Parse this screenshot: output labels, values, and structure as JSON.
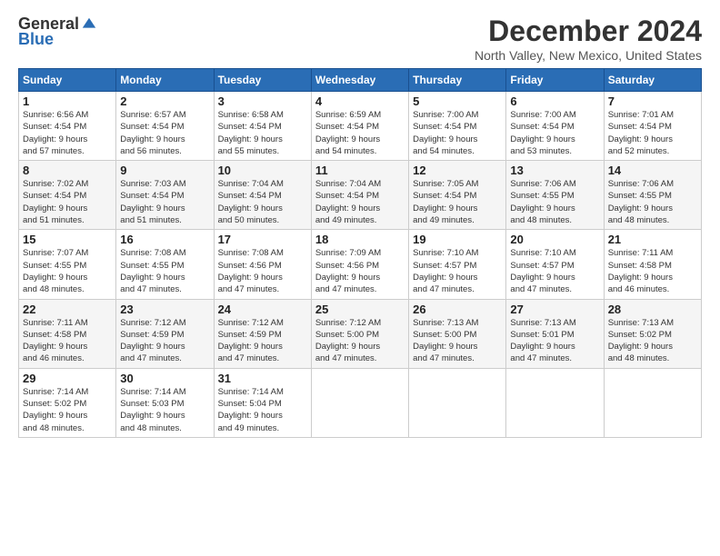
{
  "logo": {
    "general": "General",
    "blue": "Blue"
  },
  "title": "December 2024",
  "location": "North Valley, New Mexico, United States",
  "days_of_week": [
    "Sunday",
    "Monday",
    "Tuesday",
    "Wednesday",
    "Thursday",
    "Friday",
    "Saturday"
  ],
  "weeks": [
    [
      {
        "day": 1,
        "info": "Sunrise: 6:56 AM\nSunset: 4:54 PM\nDaylight: 9 hours\nand 57 minutes."
      },
      {
        "day": 2,
        "info": "Sunrise: 6:57 AM\nSunset: 4:54 PM\nDaylight: 9 hours\nand 56 minutes."
      },
      {
        "day": 3,
        "info": "Sunrise: 6:58 AM\nSunset: 4:54 PM\nDaylight: 9 hours\nand 55 minutes."
      },
      {
        "day": 4,
        "info": "Sunrise: 6:59 AM\nSunset: 4:54 PM\nDaylight: 9 hours\nand 54 minutes."
      },
      {
        "day": 5,
        "info": "Sunrise: 7:00 AM\nSunset: 4:54 PM\nDaylight: 9 hours\nand 54 minutes."
      },
      {
        "day": 6,
        "info": "Sunrise: 7:00 AM\nSunset: 4:54 PM\nDaylight: 9 hours\nand 53 minutes."
      },
      {
        "day": 7,
        "info": "Sunrise: 7:01 AM\nSunset: 4:54 PM\nDaylight: 9 hours\nand 52 minutes."
      }
    ],
    [
      {
        "day": 8,
        "info": "Sunrise: 7:02 AM\nSunset: 4:54 PM\nDaylight: 9 hours\nand 51 minutes."
      },
      {
        "day": 9,
        "info": "Sunrise: 7:03 AM\nSunset: 4:54 PM\nDaylight: 9 hours\nand 51 minutes."
      },
      {
        "day": 10,
        "info": "Sunrise: 7:04 AM\nSunset: 4:54 PM\nDaylight: 9 hours\nand 50 minutes."
      },
      {
        "day": 11,
        "info": "Sunrise: 7:04 AM\nSunset: 4:54 PM\nDaylight: 9 hours\nand 49 minutes."
      },
      {
        "day": 12,
        "info": "Sunrise: 7:05 AM\nSunset: 4:54 PM\nDaylight: 9 hours\nand 49 minutes."
      },
      {
        "day": 13,
        "info": "Sunrise: 7:06 AM\nSunset: 4:55 PM\nDaylight: 9 hours\nand 48 minutes."
      },
      {
        "day": 14,
        "info": "Sunrise: 7:06 AM\nSunset: 4:55 PM\nDaylight: 9 hours\nand 48 minutes."
      }
    ],
    [
      {
        "day": 15,
        "info": "Sunrise: 7:07 AM\nSunset: 4:55 PM\nDaylight: 9 hours\nand 48 minutes."
      },
      {
        "day": 16,
        "info": "Sunrise: 7:08 AM\nSunset: 4:55 PM\nDaylight: 9 hours\nand 47 minutes."
      },
      {
        "day": 17,
        "info": "Sunrise: 7:08 AM\nSunset: 4:56 PM\nDaylight: 9 hours\nand 47 minutes."
      },
      {
        "day": 18,
        "info": "Sunrise: 7:09 AM\nSunset: 4:56 PM\nDaylight: 9 hours\nand 47 minutes."
      },
      {
        "day": 19,
        "info": "Sunrise: 7:10 AM\nSunset: 4:57 PM\nDaylight: 9 hours\nand 47 minutes."
      },
      {
        "day": 20,
        "info": "Sunrise: 7:10 AM\nSunset: 4:57 PM\nDaylight: 9 hours\nand 47 minutes."
      },
      {
        "day": 21,
        "info": "Sunrise: 7:11 AM\nSunset: 4:58 PM\nDaylight: 9 hours\nand 46 minutes."
      }
    ],
    [
      {
        "day": 22,
        "info": "Sunrise: 7:11 AM\nSunset: 4:58 PM\nDaylight: 9 hours\nand 46 minutes."
      },
      {
        "day": 23,
        "info": "Sunrise: 7:12 AM\nSunset: 4:59 PM\nDaylight: 9 hours\nand 47 minutes."
      },
      {
        "day": 24,
        "info": "Sunrise: 7:12 AM\nSunset: 4:59 PM\nDaylight: 9 hours\nand 47 minutes."
      },
      {
        "day": 25,
        "info": "Sunrise: 7:12 AM\nSunset: 5:00 PM\nDaylight: 9 hours\nand 47 minutes."
      },
      {
        "day": 26,
        "info": "Sunrise: 7:13 AM\nSunset: 5:00 PM\nDaylight: 9 hours\nand 47 minutes."
      },
      {
        "day": 27,
        "info": "Sunrise: 7:13 AM\nSunset: 5:01 PM\nDaylight: 9 hours\nand 47 minutes."
      },
      {
        "day": 28,
        "info": "Sunrise: 7:13 AM\nSunset: 5:02 PM\nDaylight: 9 hours\nand 48 minutes."
      }
    ],
    [
      {
        "day": 29,
        "info": "Sunrise: 7:14 AM\nSunset: 5:02 PM\nDaylight: 9 hours\nand 48 minutes."
      },
      {
        "day": 30,
        "info": "Sunrise: 7:14 AM\nSunset: 5:03 PM\nDaylight: 9 hours\nand 48 minutes."
      },
      {
        "day": 31,
        "info": "Sunrise: 7:14 AM\nSunset: 5:04 PM\nDaylight: 9 hours\nand 49 minutes."
      },
      null,
      null,
      null,
      null
    ]
  ]
}
